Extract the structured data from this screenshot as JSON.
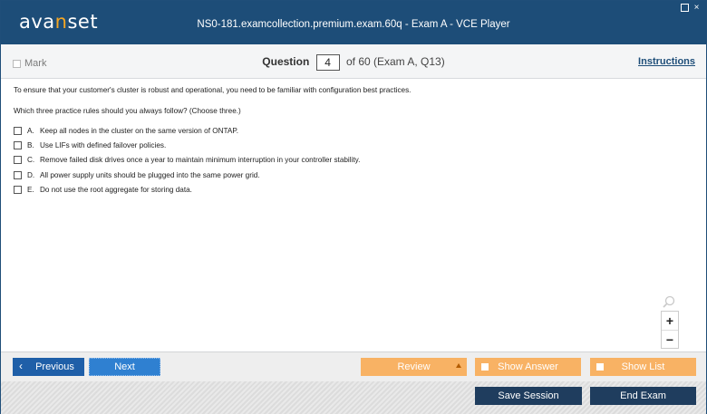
{
  "app": {
    "logo_left": "ava",
    "logo_accent": "n",
    "logo_right": "set",
    "title": "NS0-181.examcollection.premium.exam.60q - Exam A - VCE Player"
  },
  "question_bar": {
    "mark_label": "Mark",
    "question_label": "Question",
    "question_number": "4",
    "of_text": "of 60 (Exam A, Q13)",
    "instructions_label": "Instructions"
  },
  "question": {
    "stem": "To ensure that your customer's cluster is robust and operational, you need to be familiar with configuration best practices.",
    "prompt": "Which three practice rules should you always follow? (Choose three.)",
    "options": [
      {
        "letter": "A.",
        "text": "Keep all nodes in the cluster on the same version of ONTAP."
      },
      {
        "letter": "B.",
        "text": "Use LIFs with defined failover policies."
      },
      {
        "letter": "C.",
        "text": "Remove failed disk drives once a year to maintain minimum interruption in your controller stability."
      },
      {
        "letter": "D.",
        "text": "All power supply units should be plugged into the same power grid."
      },
      {
        "letter": "E.",
        "text": "Do not use the root aggregate for storing data."
      }
    ]
  },
  "zoom": {
    "plus": "+",
    "minus": "−"
  },
  "footer": {
    "previous_label": "Previous",
    "next_label": "Next",
    "review_label": "Review",
    "show_answer_label": "Show Answer",
    "show_list_label": "Show List",
    "save_session_label": "Save Session",
    "end_exam_label": "End Exam"
  },
  "colors": {
    "titlebar": "#1d4d78",
    "accent_orange": "#f8b264",
    "previous_blue": "#1f5fa8",
    "next_blue": "#2f80d1",
    "dark_button": "#1f3d5e"
  }
}
